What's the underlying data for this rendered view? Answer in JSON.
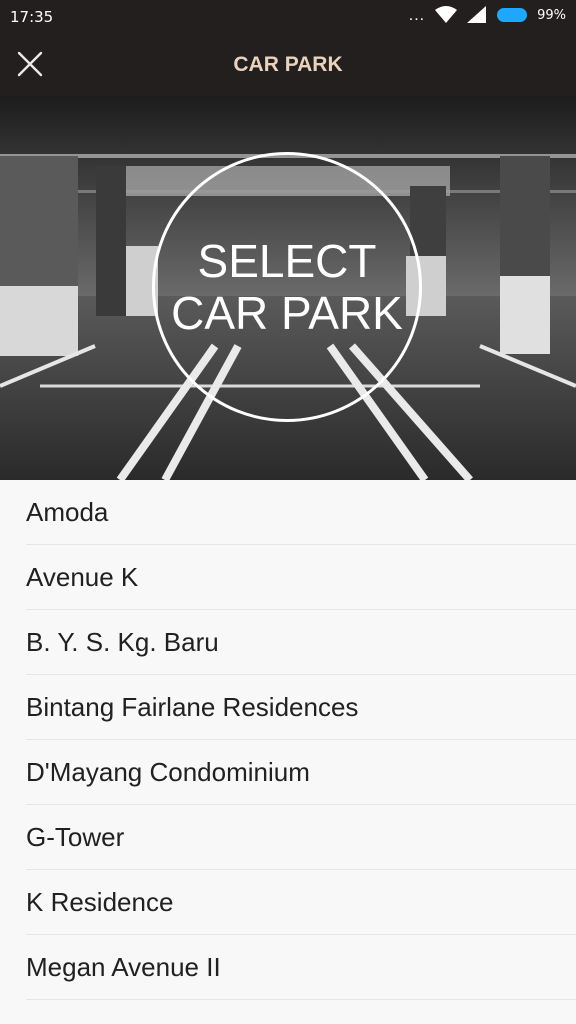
{
  "status_bar": {
    "time": "17:35",
    "signal_dots": "...",
    "battery_percent": "99%",
    "battery_color": "#1ea7ff"
  },
  "app_bar": {
    "close_icon": "close-icon",
    "title": "CAR PARK",
    "background": "#231f1e",
    "title_color": "#e9d3bd"
  },
  "hero": {
    "line1": "SELECT",
    "line2": "CAR PARK"
  },
  "car_parks": [
    "Amoda",
    "Avenue K",
    "B. Y. S. Kg. Baru",
    "Bintang Fairlane Residences",
    "D'Mayang Condominium",
    "G-Tower",
    "K Residence",
    "Megan Avenue II"
  ]
}
